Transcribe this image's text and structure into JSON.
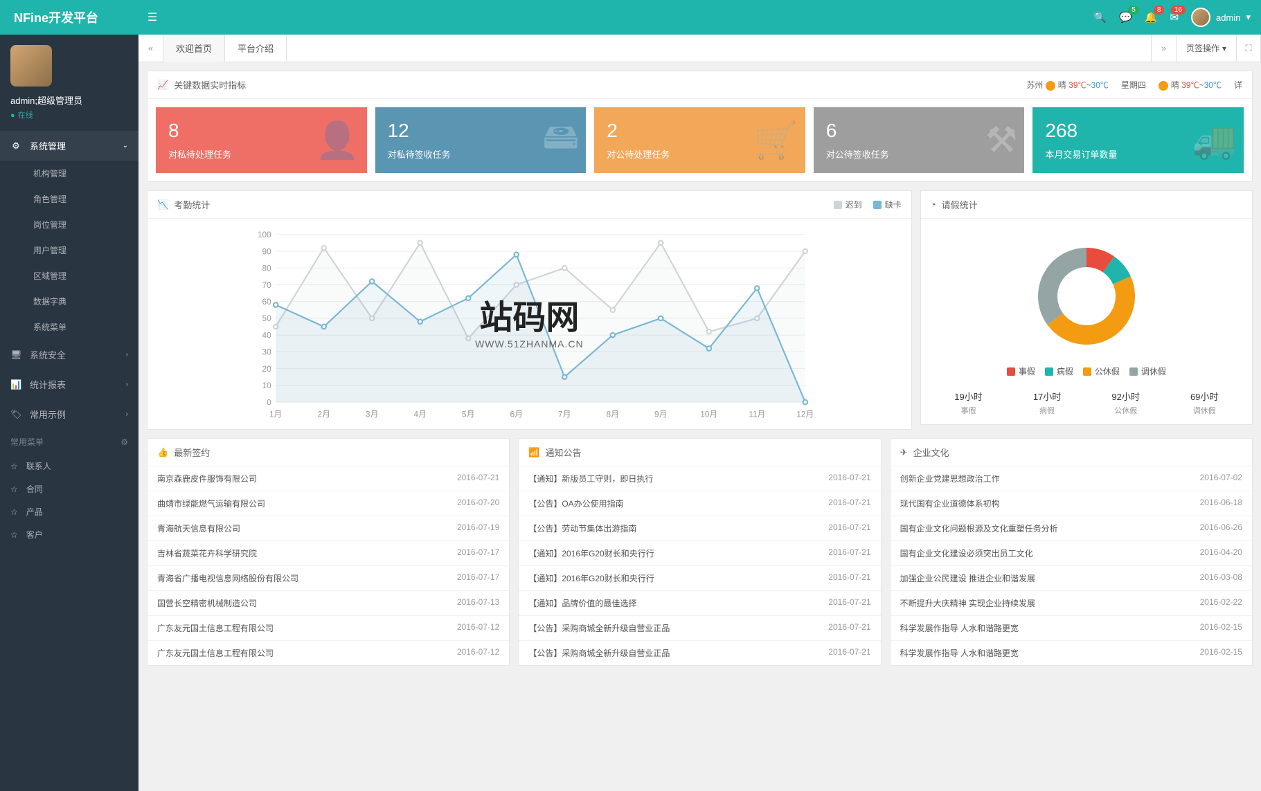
{
  "app_name": "NFine开发平台",
  "header": {
    "badges": {
      "comment": "5",
      "bell": "8",
      "mail": "16"
    },
    "user": "admin"
  },
  "profile": {
    "name": "admin;超级管理员",
    "status": "在线"
  },
  "nav": {
    "sys_mgmt": "系统管理",
    "subs": [
      "机构管理",
      "角色管理",
      "岗位管理",
      "用户管理",
      "区域管理",
      "数据字典",
      "系统菜单"
    ],
    "security": "系统安全",
    "reports": "统计报表",
    "examples": "常用示例",
    "fav_title": "常用菜单",
    "favs": [
      "联系人",
      "合同",
      "产品",
      "客户"
    ]
  },
  "tabs": {
    "home": "欢迎首页",
    "intro": "平台介绍",
    "ops": "页签操作"
  },
  "indicators": {
    "title": "关键数据实时指标",
    "weather": {
      "city1": "苏州",
      "cond1": "晴",
      "hi1": "39℃",
      "lo1": "30℃",
      "day": "星期四",
      "cond2": "晴",
      "hi2": "39℃",
      "lo2": "30℃",
      "detail": "详"
    }
  },
  "stats": [
    {
      "num": "8",
      "label": "对私待处理任务",
      "color": "#ef6f66",
      "icon": "👤"
    },
    {
      "num": "12",
      "label": "对私待签收任务",
      "color": "#5a95b2",
      "icon": "🖴"
    },
    {
      "num": "2",
      "label": "对公待处理任务",
      "color": "#f3a859",
      "icon": "🛒"
    },
    {
      "num": "6",
      "label": "对公待签收任务",
      "color": "#9e9e9e",
      "icon": "⚒"
    },
    {
      "num": "268",
      "label": "本月交易订单数量",
      "color": "#1fb5ac",
      "icon": "🚚"
    }
  ],
  "attendance": {
    "title": "考勤统计",
    "legend": [
      {
        "label": "迟到",
        "color": "#cfd4d8"
      },
      {
        "label": "缺卡",
        "color": "#78b7d6"
      }
    ]
  },
  "chart_data": {
    "type": "line",
    "categories": [
      "1月",
      "2月",
      "3月",
      "4月",
      "5月",
      "6月",
      "7月",
      "8月",
      "9月",
      "10月",
      "11月",
      "12月"
    ],
    "series": [
      {
        "name": "迟到",
        "color": "#cfd4d8",
        "values": [
          45,
          92,
          50,
          95,
          38,
          70,
          80,
          55,
          95,
          42,
          50,
          90
        ]
      },
      {
        "name": "缺卡",
        "color": "#78b7d6",
        "values": [
          58,
          45,
          72,
          48,
          62,
          88,
          15,
          40,
          50,
          32,
          68,
          0
        ]
      }
    ],
    "ylim": [
      0,
      100
    ],
    "ystep": 10
  },
  "leave": {
    "title": "请假统计",
    "donut": [
      {
        "label": "事假",
        "color": "#e74c3c",
        "value": 19
      },
      {
        "label": "病假",
        "color": "#1fb5ac",
        "value": 17
      },
      {
        "label": "公休假",
        "color": "#f39c12",
        "value": 92
      },
      {
        "label": "调休假",
        "color": "#95a5a6",
        "value": 69
      }
    ],
    "stats": [
      {
        "val": "19小时",
        "lbl": "事假"
      },
      {
        "val": "17小时",
        "lbl": "病假"
      },
      {
        "val": "92小时",
        "lbl": "公休假"
      },
      {
        "val": "69小时",
        "lbl": "调休假"
      }
    ]
  },
  "contracts": {
    "title": "最新签约",
    "items": [
      {
        "t": "南京森鹿皮件服饰有限公司",
        "d": "2016-07-21"
      },
      {
        "t": "曲靖市绿能燃气运输有限公司",
        "d": "2016-07-20"
      },
      {
        "t": "青海航天信息有限公司",
        "d": "2016-07-19"
      },
      {
        "t": "吉林省蔬菜花卉科学研究院",
        "d": "2016-07-17"
      },
      {
        "t": "青海省广播电视信息网络股份有限公司",
        "d": "2016-07-17"
      },
      {
        "t": "国营长空精密机械制造公司",
        "d": "2016-07-13"
      },
      {
        "t": "广东友元国土信息工程有限公司",
        "d": "2016-07-12"
      },
      {
        "t": "广东友元国土信息工程有限公司",
        "d": "2016-07-12"
      }
    ]
  },
  "notices": {
    "title": "通知公告",
    "items": [
      {
        "t": "【通知】新版员工守则，即日执行",
        "d": "2016-07-21"
      },
      {
        "t": "【公告】OA办公使用指南",
        "d": "2016-07-21"
      },
      {
        "t": "【公告】劳动节集体出游指南",
        "d": "2016-07-21"
      },
      {
        "t": "【通知】2016年G20财长和央行行",
        "d": "2016-07-21"
      },
      {
        "t": "【通知】2016年G20财长和央行行",
        "d": "2016-07-21"
      },
      {
        "t": "【通知】品牌价值的最佳选择",
        "d": "2016-07-21"
      },
      {
        "t": "【公告】采购商城全新升级自营业正品",
        "d": "2016-07-21"
      },
      {
        "t": "【公告】采购商城全新升级自营业正品",
        "d": "2016-07-21"
      }
    ]
  },
  "culture": {
    "title": "企业文化",
    "items": [
      {
        "t": "创新企业党建思想政治工作",
        "d": "2016-07-02"
      },
      {
        "t": "现代国有企业道德体系初构",
        "d": "2016-06-18"
      },
      {
        "t": "国有企业文化问题根源及文化重塑任务分析",
        "d": "2016-06-26"
      },
      {
        "t": "国有企业文化建设必须突出员工文化",
        "d": "2016-04-20"
      },
      {
        "t": "加强企业公民建设 推进企业和谐发展",
        "d": "2016-03-08"
      },
      {
        "t": "不断提升大庆精神 实现企业持续发展",
        "d": "2016-02-22"
      },
      {
        "t": "科学发展作指导 人水和谐路更宽",
        "d": "2016-02-15"
      },
      {
        "t": "科学发展作指导 人水和谐路更宽",
        "d": "2016-02-15"
      }
    ]
  },
  "watermark": {
    "text": "站码网",
    "url": "WWW.51ZHANMA.CN"
  }
}
